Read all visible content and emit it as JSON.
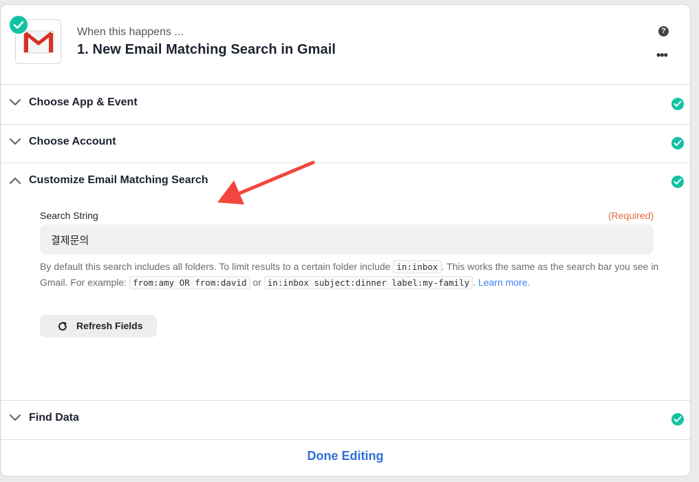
{
  "step": {
    "eyebrow": "When this happens ...",
    "title": "1. New Email Matching Search in Gmail",
    "help_glyph": "?",
    "more_glyph": "•••",
    "app_icon": "gmail-icon",
    "status_icon": "check-icon"
  },
  "sections": [
    {
      "label": "Choose App & Event",
      "expanded": false,
      "complete": true
    },
    {
      "label": "Choose Account",
      "expanded": false,
      "complete": true
    },
    {
      "label": "Customize Email Matching Search",
      "expanded": true,
      "complete": true
    },
    {
      "label": "Find Data",
      "expanded": false,
      "complete": true
    }
  ],
  "search_field": {
    "label": "Search String",
    "required": "(Required)",
    "value": "결제문의",
    "help": {
      "t1": "By default this search includes all folders. To limit results to a certain folder include ",
      "c1": "in:inbox",
      "t2": ". This works the same as the search bar you see in Gmail. For example: ",
      "c2": "from:amy OR from:david",
      "t3": " or ",
      "c3": "in:inbox subject:dinner label:my-family",
      "t4": ". ",
      "link": "Learn more."
    }
  },
  "refresh_button": {
    "label": "Refresh Fields",
    "icon": "refresh-icon"
  },
  "footer": {
    "done_label": "Done Editing"
  },
  "colors": {
    "success": "#13c2a3",
    "required": "#e06a3c",
    "link": "#3b82f6",
    "done": "#2d6fd9",
    "annotation_arrow": "#f2453d"
  }
}
